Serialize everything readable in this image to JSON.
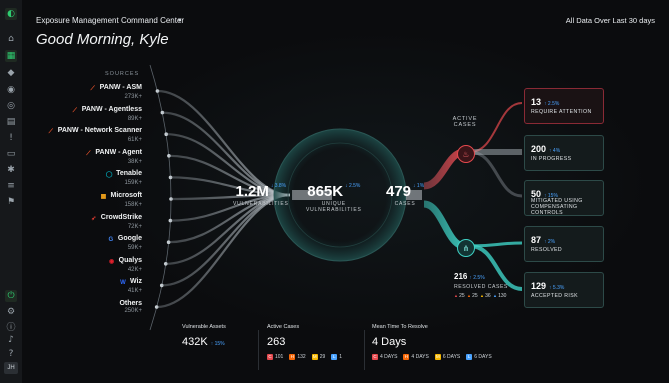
{
  "header": {
    "title": "Exposure Management Command Center",
    "range": "All Data Over Last 30 days",
    "greeting": "Good Morning, Kyle"
  },
  "rail": {
    "avatar": "JH",
    "icons": [
      "logo-icon",
      "home-icon",
      "grid-icon",
      "shield-icon",
      "eye-icon",
      "target-icon",
      "document-icon",
      "alert-icon",
      "folder-icon",
      "gear-icon",
      "list-icon",
      "flag-icon",
      "power-icon",
      "settings-icon",
      "info-icon",
      "bell-icon",
      "help-icon"
    ]
  },
  "sources": {
    "heading": "SOURCES",
    "items": [
      {
        "name": "PANW - ASM",
        "count": "273K+",
        "logo": "panw",
        "color": "#fa582d"
      },
      {
        "name": "PANW - Agentless",
        "count": "89K+",
        "logo": "panw",
        "color": "#fa582d"
      },
      {
        "name": "PANW - Network Scanner",
        "count": "61K+",
        "logo": "panw",
        "color": "#fa582d"
      },
      {
        "name": "PANW - Agent",
        "count": "38K+",
        "logo": "panw",
        "color": "#fa582d"
      },
      {
        "name": "Tenable",
        "count": "159K+",
        "logo": "tenable",
        "color": "#00a5b5"
      },
      {
        "name": "Microsoft",
        "count": "158K+",
        "logo": "microsoft",
        "color": "#f3a41b"
      },
      {
        "name": "CrowdStrike",
        "count": "72K+",
        "logo": "crowdstrike",
        "color": "#e03c31"
      },
      {
        "name": "Google",
        "count": "59K+",
        "logo": "google",
        "color": "#4285f4"
      },
      {
        "name": "Qualys",
        "count": "42K+",
        "logo": "qualys",
        "color": "#e0202c"
      },
      {
        "name": "Wiz",
        "count": "41K+",
        "logo": "wiz",
        "color": "#2f6bff"
      },
      {
        "name": "Others",
        "count": "250K+",
        "logo": "",
        "color": "#8a939b"
      }
    ]
  },
  "flow": {
    "vulnerabilities": {
      "value": "1.2M",
      "delta": "↓ 3.8%",
      "label": "VULNERABILITIES"
    },
    "unique": {
      "value": "865K",
      "delta": "↓ 2.5%",
      "label1": "UNIQUE",
      "label2": "VULNERABILITIES"
    },
    "cases": {
      "value": "479",
      "delta": "↓ 1%",
      "label": "CASES"
    },
    "active_cases_label1": "ACTIVE",
    "active_cases_label2": "CASES",
    "resolved": {
      "value": "216",
      "delta": "↑ 2.5%",
      "label": "RESOLVED CASES"
    },
    "severity": [
      {
        "value": "25",
        "color": "#e5484d"
      },
      {
        "value": "25",
        "color": "#f76808"
      },
      {
        "value": "36",
        "color": "#f5b700"
      },
      {
        "value": "130",
        "color": "#4aa3ff"
      }
    ]
  },
  "cards": [
    {
      "value": "13",
      "delta": "↑ 2.5%",
      "label1": "REQUIRE ATTENTION",
      "label2": "",
      "label3": "",
      "alert": true
    },
    {
      "value": "200",
      "delta": "↑ 4%",
      "label1": "IN PROGRESS",
      "label2": "",
      "label3": "",
      "alert": false
    },
    {
      "value": "50",
      "delta": "↑ 15%",
      "label1": "MITIGATED USING",
      "label2": "COMPENSATING",
      "label3": "CONTROLS",
      "alert": false
    },
    {
      "value": "87",
      "delta": "↑ 2%",
      "label1": "RESOLVED",
      "label2": "",
      "label3": "",
      "alert": false
    },
    {
      "value": "129",
      "delta": "↑ 5.3%",
      "label1": "ACCEPTED RISK",
      "label2": "",
      "label3": "",
      "alert": false
    }
  ],
  "bottom": {
    "vuln_assets": {
      "label": "Vulnerable Assets",
      "value": "432K",
      "delta": "↑ 15%"
    },
    "active_cases": {
      "label": "Active Cases",
      "value": "263",
      "chips": [
        {
          "letter": "C",
          "value": "101",
          "color": "#e5484d"
        },
        {
          "letter": "H",
          "value": "132",
          "color": "#f76808"
        },
        {
          "letter": "M",
          "value": "29",
          "color": "#f5b700"
        },
        {
          "letter": "L",
          "value": "1",
          "color": "#4aa3ff"
        }
      ]
    },
    "mttr": {
      "label": "Mean Time To Resolve",
      "value": "4 Days",
      "chips": [
        {
          "letter": "C",
          "value": "4 DAYS",
          "color": "#e5484d"
        },
        {
          "letter": "H",
          "value": "4 DAYS",
          "color": "#f76808"
        },
        {
          "letter": "M",
          "value": "6 DAYS",
          "color": "#f5b700"
        },
        {
          "letter": "L",
          "value": "6 DAYS",
          "color": "#4aa3ff"
        }
      ]
    }
  }
}
